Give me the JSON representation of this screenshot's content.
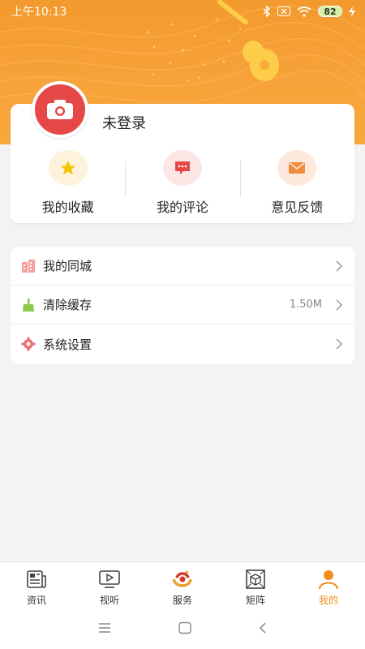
{
  "status_bar": {
    "time": "上午10:13",
    "battery": "82"
  },
  "profile": {
    "login_status": "未登录"
  },
  "quick_actions": [
    {
      "label": "我的收藏",
      "icon": "star-icon",
      "color": "#f5c400"
    },
    {
      "label": "我的评论",
      "icon": "comment-icon",
      "color": "#e64848"
    },
    {
      "label": "意见反馈",
      "icon": "mail-icon",
      "color": "#f08c3c"
    }
  ],
  "menu": [
    {
      "label": "我的同城",
      "icon": "building-icon",
      "value": ""
    },
    {
      "label": "清除缓存",
      "icon": "broom-icon",
      "value": "1.50M"
    },
    {
      "label": "系统设置",
      "icon": "gear-icon",
      "value": ""
    }
  ],
  "bottom_nav": [
    {
      "label": "资讯",
      "icon": "news-icon",
      "active": false
    },
    {
      "label": "视听",
      "icon": "tv-icon",
      "active": false
    },
    {
      "label": "服务",
      "icon": "service-logo-icon",
      "active": false
    },
    {
      "label": "矩阵",
      "icon": "matrix-icon",
      "active": false
    },
    {
      "label": "我的",
      "icon": "person-icon",
      "active": true
    }
  ],
  "colors": {
    "accent": "#f08c1c",
    "header": "#f7a23a",
    "avatar": "#e64848"
  }
}
